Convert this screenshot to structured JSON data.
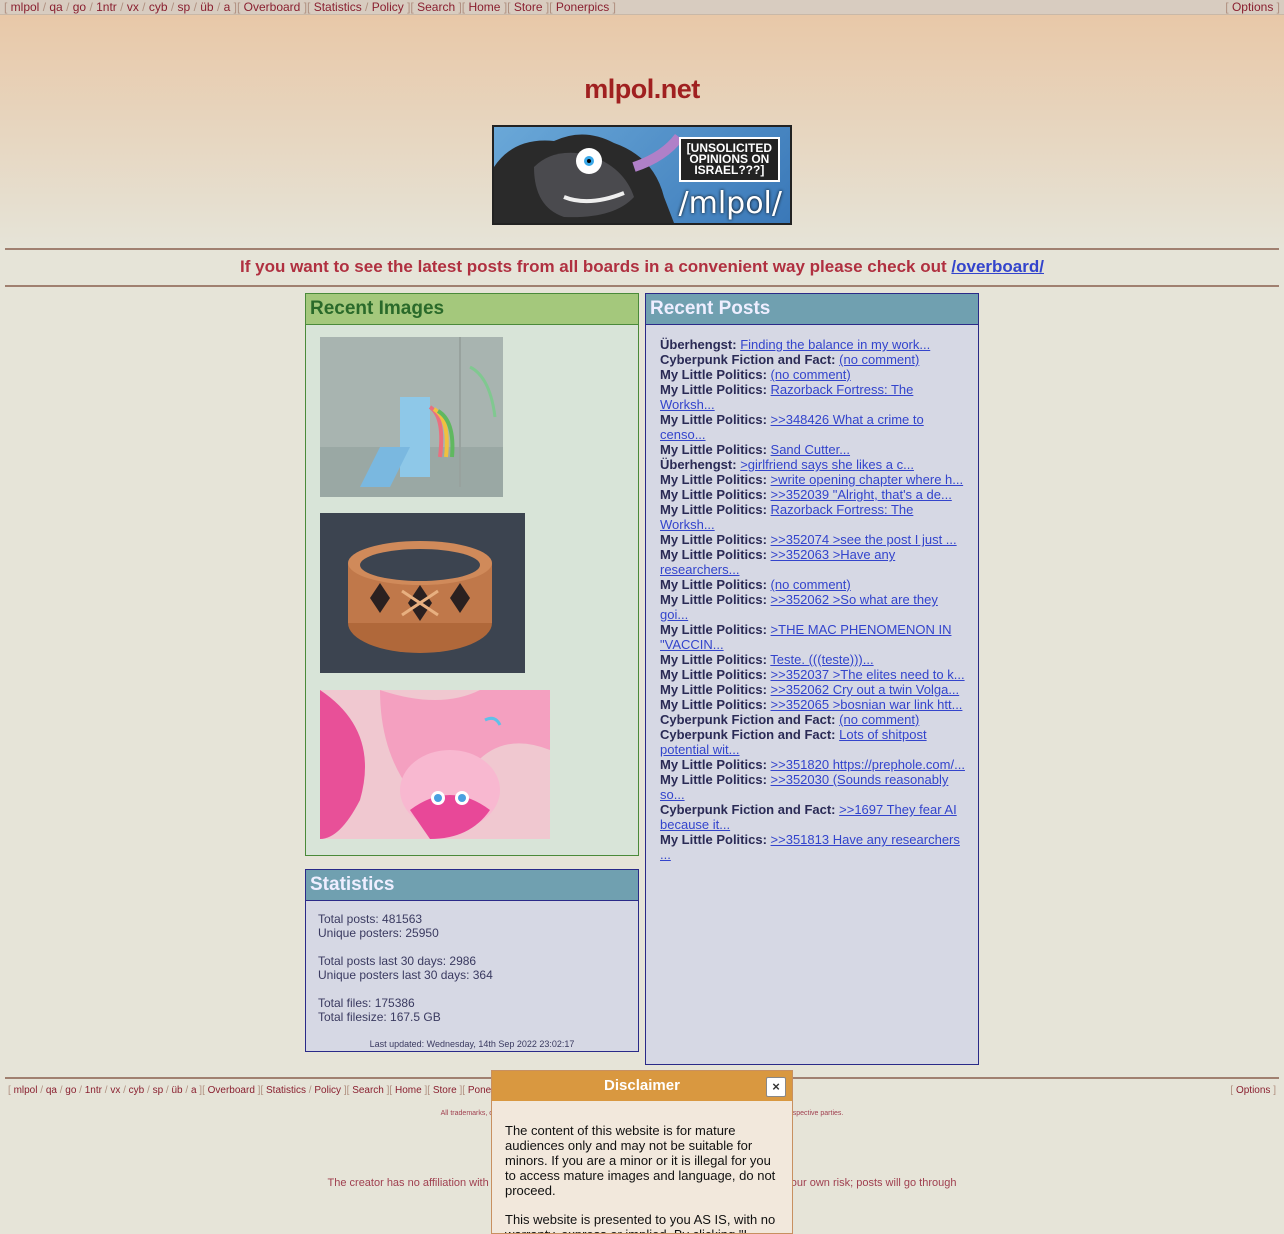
{
  "topnav": {
    "boards": [
      "mlpol",
      "qa",
      "go",
      "1ntr",
      "vx",
      "cyb",
      "sp",
      "üb",
      "a"
    ],
    "overboard": "Overboard",
    "statistics": "Statistics",
    "policy": "Policy",
    "search": "Search",
    "home": "Home",
    "store": "Store",
    "ponerpics": "Ponerpics",
    "options": "Options"
  },
  "site": {
    "title": "mlpol.net",
    "banner_text": "[UNSOLICITED\nOPINIONS ON\nISRAEL???]",
    "banner_board": "/mlpol/"
  },
  "notice": {
    "text": "If you want to see the latest posts from all boards in a convenient way please check out",
    "link": "/overboard/"
  },
  "recent_images": {
    "title": "Recent Images"
  },
  "statistics": {
    "title": "Statistics",
    "total_posts": "Total posts: 481563",
    "unique_posters": "Unique posters: 25950",
    "posts_30": "Total posts last 30 days: 2986",
    "posters_30": "Unique posters last 30 days: 364",
    "total_files": "Total files: 175386",
    "total_filesize": "Total filesize: 167.5 GB",
    "updated": "Last updated: Wednesday, 14th Sep 2022 23:02:17"
  },
  "recent_posts": {
    "title": "Recent Posts",
    "items": [
      {
        "board": "Überhengst:",
        "text": "Finding the balance in my work..."
      },
      {
        "board": "Cyberpunk Fiction and Fact:",
        "text": "(no comment)"
      },
      {
        "board": "My Little Politics:",
        "text": "(no comment)"
      },
      {
        "board": "My Little Politics:",
        "text": "Razorback Fortress: The Worksh..."
      },
      {
        "board": "My Little Politics:",
        "text": ">>348426 What a crime to censo..."
      },
      {
        "board": "My Little Politics:",
        "text": "Sand Cutter..."
      },
      {
        "board": "Überhengst:",
        "text": ">girlfriend says she likes a c..."
      },
      {
        "board": "My Little Politics:",
        "text": ">write opening chapter where h..."
      },
      {
        "board": "My Little Politics:",
        "text": ">>352039 \"Alright, that's a de..."
      },
      {
        "board": "My Little Politics:",
        "text": "Razorback Fortress: The Worksh..."
      },
      {
        "board": "My Little Politics:",
        "text": ">>352074 >see the post I just ..."
      },
      {
        "board": "My Little Politics:",
        "text": ">>352063 >Have any researchers..."
      },
      {
        "board": "My Little Politics:",
        "text": "(no comment)"
      },
      {
        "board": "My Little Politics:",
        "text": ">>352062 >So what are they goi..."
      },
      {
        "board": "My Little Politics:",
        "text": ">THE MAC PHENOMENON IN \"VACCIN..."
      },
      {
        "board": "My Little Politics:",
        "text": "Teste. (((teste)))..."
      },
      {
        "board": "My Little Politics:",
        "text": ">>352037 >The elites need to k..."
      },
      {
        "board": "My Little Politics:",
        "text": ">>352062 Cry out a twin Volga..."
      },
      {
        "board": "My Little Politics:",
        "text": ">>352065 >bosnian war link htt..."
      },
      {
        "board": "Cyberpunk Fiction and Fact:",
        "text": "(no comment)"
      },
      {
        "board": "Cyberpunk Fiction and Fact:",
        "text": "Lots of shitpost potential wit..."
      },
      {
        "board": "My Little Politics:",
        "text": ">>351820 https://prephole.com/..."
      },
      {
        "board": "My Little Politics:",
        "text": ">>352030 (Sounds reasonably so..."
      },
      {
        "board": "Cyberpunk Fiction and Fact:",
        "text": ">>1697 They fear AI because it..."
      },
      {
        "board": "My Little Politics:",
        "text": ">>351813 Have any researchers ..."
      }
    ]
  },
  "footer": {
    "fine_print": "All trademarks, copyrights, comments, and images on this page are owned by and are the responsibility of their respective parties.",
    "creator": "The creator has no affiliation with the content. It is unsupervised and is not moderated. Use at your own risk; posts will go through"
  },
  "disclaimer": {
    "title": "Disclaimer",
    "close": "×",
    "p1": "The content of this website is for mature audiences only and may not be suitable for minors. If you are a minor or it is illegal for you to access mature images and language, do not proceed.",
    "p2": "This website is presented to you AS IS, with no warranty, express or implied. By clicking \"I Agree\" you agree not to hold the creator responsible for any damages from your use of the website."
  }
}
